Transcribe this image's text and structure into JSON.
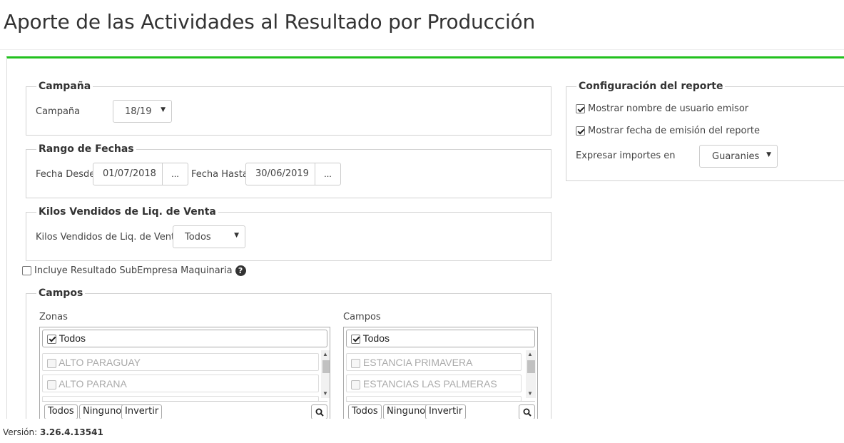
{
  "page": {
    "title": "Aporte de las Actividades al Resultado por Producción"
  },
  "campana": {
    "legend": "Campaña",
    "label": "Campaña",
    "selected": "18/19"
  },
  "rango_fechas": {
    "legend": "Rango de Fechas",
    "desde_label": "Fecha Desde",
    "desde_value": "01/07/2018",
    "hasta_label": "Fecha Hasta",
    "hasta_value": "30/06/2019",
    "picker_label": "..."
  },
  "kilos": {
    "legend": "Kilos Vendidos de Liq. de Venta",
    "label": "Kilos Vendidos de Liq. de Venta",
    "selected": "Todos"
  },
  "subempresa": {
    "label": "Incluye Resultado SubEmpresa Maquinaria",
    "checked": false
  },
  "campos": {
    "legend": "Campos",
    "zonas": {
      "title": "Zonas",
      "all_label": "Todos",
      "items": [
        "ALTO PARAGUAY",
        "ALTO PARANA"
      ]
    },
    "campos_list": {
      "title": "Campos",
      "all_label": "Todos",
      "items": [
        "ESTANCIA PRIMAVERA",
        "ESTANCIAS LAS PALMERAS"
      ]
    },
    "buttons": {
      "todos": "Todos",
      "ninguno": "Ninguno",
      "invertir": "Invertir"
    }
  },
  "configuracion": {
    "legend": "Configuración del reporte",
    "mostrar_usuario": "Mostrar nombre de usuario emisor",
    "mostrar_fecha": "Mostrar fecha de emisión del reporte",
    "importes_label": "Expresar importes en",
    "importes_selected": "Guaranies"
  },
  "footer": {
    "version_label": "Versión:",
    "version_value": "3.26.4.13541"
  },
  "colors": {
    "accent": "#22c11e"
  }
}
